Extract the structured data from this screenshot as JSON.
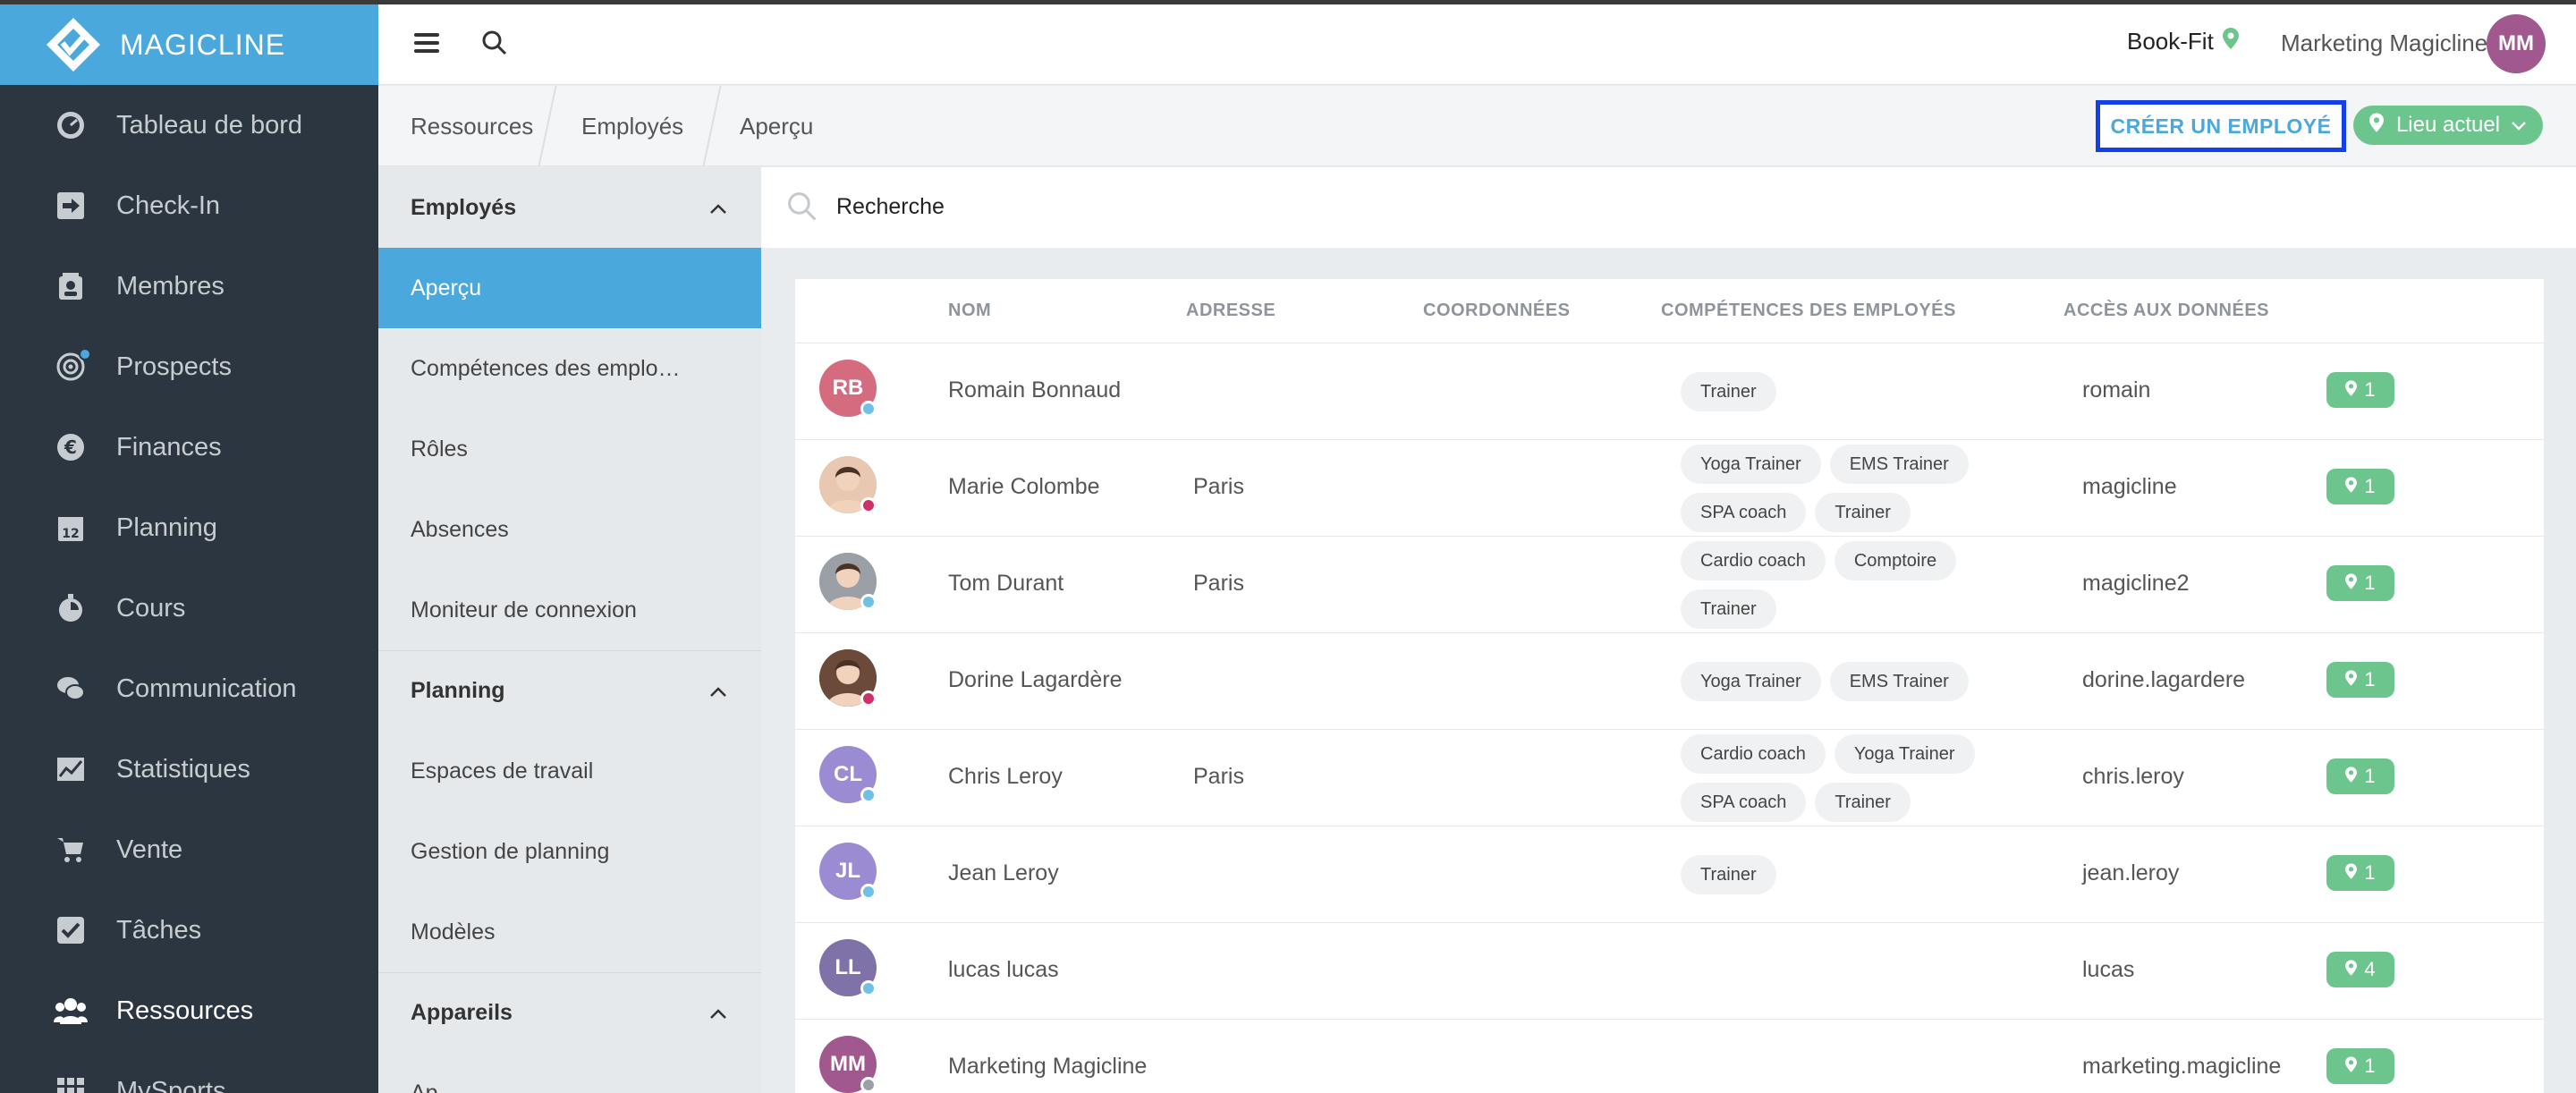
{
  "brand": {
    "name": "MAGICLINE"
  },
  "sidebar": {
    "items": [
      {
        "label": "Tableau de bord",
        "icon": "dashboard-icon"
      },
      {
        "label": "Check-In",
        "icon": "check-in-icon"
      },
      {
        "label": "Membres",
        "icon": "members-icon"
      },
      {
        "label": "Prospects",
        "icon": "prospects-icon"
      },
      {
        "label": "Finances",
        "icon": "euro-icon"
      },
      {
        "label": "Planning",
        "icon": "calendar-icon"
      },
      {
        "label": "Cours",
        "icon": "stopwatch-icon"
      },
      {
        "label": "Communication",
        "icon": "chat-icon"
      },
      {
        "label": "Statistiques",
        "icon": "chart-icon"
      },
      {
        "label": "Vente",
        "icon": "cart-icon"
      },
      {
        "label": "Tâches",
        "icon": "checkbox-icon"
      },
      {
        "label": "Ressources",
        "icon": "users-icon"
      },
      {
        "label": "MySports",
        "icon": "grid-icon"
      }
    ]
  },
  "header": {
    "location": "Book-Fit",
    "user_name": "Marketing Magicline",
    "user_initials": "MM"
  },
  "breadcrumb": [
    "Ressources",
    "Employés",
    "Aperçu"
  ],
  "actions": {
    "create_label": "CRÉER UN EMPLOYÉ",
    "location_filter": "Lieu actuel"
  },
  "subnav": {
    "sections": [
      {
        "title": "Employés",
        "items": [
          "Aperçu",
          "Compétences des emplo…",
          "Rôles",
          "Absences",
          "Moniteur de connexion"
        ]
      },
      {
        "title": "Planning",
        "items": [
          "Espaces de travail",
          "Gestion de planning",
          "Modèles"
        ]
      },
      {
        "title": "Appareils",
        "items": [
          "Ap"
        ]
      }
    ]
  },
  "search": {
    "placeholder": "Recherche"
  },
  "table": {
    "headers": [
      "NOM",
      "ADRESSE",
      "COORDONNÉES",
      "COMPÉTENCES DES EMPLOYÉS",
      "ACCÈS AUX DONNÉES"
    ],
    "rows": [
      {
        "initials": "RB",
        "avatar_color": "#d56b7e",
        "status_color": "#6ec1e4",
        "name": "Romain Bonnaud",
        "address": "",
        "skills": [
          "Trainer"
        ],
        "access": "romain",
        "locations": "1"
      },
      {
        "initials": "",
        "avatar_color": "#e8c8b0",
        "status_color": "#d0306a",
        "name": "Marie Colombe",
        "address": "Paris",
        "skills": [
          "Yoga Trainer",
          "EMS Trainer",
          "SPA coach",
          "Trainer"
        ],
        "access": "magicline",
        "locations": "1"
      },
      {
        "initials": "",
        "avatar_color": "#9aa0a6",
        "status_color": "#6ec1e4",
        "name": "Tom Durant",
        "address": "Paris",
        "skills": [
          "Cardio coach",
          "Comptoire",
          "Trainer"
        ],
        "access": "magicline2",
        "locations": "1"
      },
      {
        "initials": "",
        "avatar_color": "#6b4a3a",
        "status_color": "#d0306a",
        "name": "Dorine Lagardère",
        "address": "",
        "skills": [
          "Yoga Trainer",
          "EMS Trainer"
        ],
        "access": "dorine.lagardere",
        "locations": "1"
      },
      {
        "initials": "CL",
        "avatar_color": "#9b8bd3",
        "status_color": "#6ec1e4",
        "name": "Chris Leroy",
        "address": "Paris",
        "skills": [
          "Cardio coach",
          "Yoga Trainer",
          "SPA coach",
          "Trainer"
        ],
        "access": "chris.leroy",
        "locations": "1"
      },
      {
        "initials": "JL",
        "avatar_color": "#9b8bd3",
        "status_color": "#6ec1e4",
        "name": "Jean Leroy",
        "address": "",
        "skills": [
          "Trainer"
        ],
        "access": "jean.leroy",
        "locations": "1"
      },
      {
        "initials": "LL",
        "avatar_color": "#7e72a8",
        "status_color": "#6ec1e4",
        "name": "lucas lucas",
        "address": "",
        "skills": [],
        "access": "lucas",
        "locations": "4"
      },
      {
        "initials": "MM",
        "avatar_color": "#a0588f",
        "status_color": "#9aa0a6",
        "name": "Marketing Magicline",
        "address": "",
        "skills": [],
        "access": "marketing.magicline",
        "locations": "1"
      }
    ]
  },
  "colors": {
    "brand_blue": "#4aa8dc",
    "sidebar_bg": "#2c3640",
    "green": "#6cc58c",
    "highlight": "#1440e8"
  }
}
